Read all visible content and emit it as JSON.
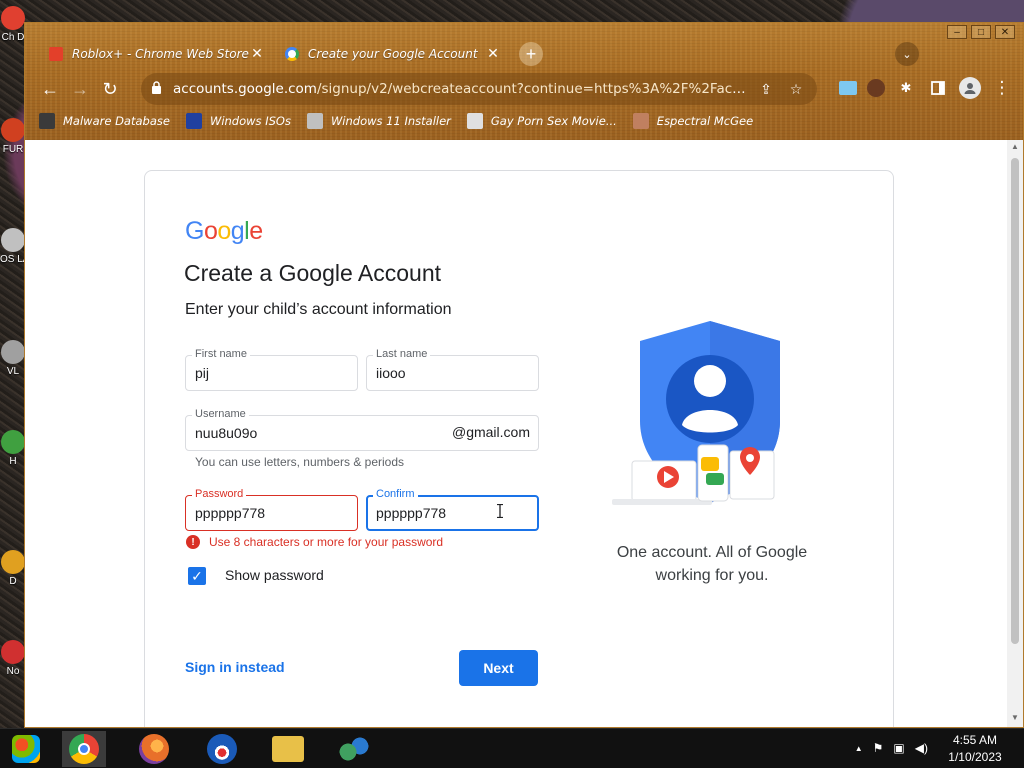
{
  "desktop": {
    "icons": [
      {
        "label": "Ch D",
        "color": "#e04030"
      },
      {
        "label": "FUR",
        "color": "#d04020"
      },
      {
        "label": "OS LA",
        "color": "#c0c0c0"
      },
      {
        "label": "VL",
        "color": "#a0a0a0"
      },
      {
        "label": "H",
        "color": "#40a040"
      },
      {
        "label": "D",
        "color": "#e0a020"
      },
      {
        "label": "No",
        "color": "#d03030"
      }
    ]
  },
  "browser": {
    "window_controls": {
      "minimize": "–",
      "maximize": "□",
      "close": "✕"
    },
    "tabs": [
      {
        "title": "Roblox+ - Chrome Web Store",
        "favicon": "roblox-icon",
        "close": "✕"
      },
      {
        "title": "Create your Google Account",
        "favicon": "google-icon",
        "close": "✕"
      }
    ],
    "new_tab": "+",
    "tab_search": "⌄",
    "toolbar": {
      "back": "←",
      "forward": "→",
      "reload": "↻",
      "lock": "🔒",
      "url_host": "accounts.google.com",
      "url_path": "/signup/v2/webcreateaccount?continue=https%3A%2F%2Faccount...",
      "share": "⇪",
      "star": "☆"
    },
    "extensions": [
      {
        "name": "flag-extension-icon",
        "glyph": "≡",
        "color": "#7ec8f0"
      },
      {
        "name": "avatar-extension-icon",
        "glyph": "●",
        "color": "#6a3a20"
      },
      {
        "name": "puzzle-icon",
        "glyph": "✱",
        "color": "transparent"
      },
      {
        "name": "side-panel-icon",
        "glyph": "▮",
        "color": "transparent"
      },
      {
        "name": "profile-icon",
        "glyph": "●",
        "color": "#e8e8e8"
      },
      {
        "name": "menu-icon",
        "glyph": "⋮",
        "color": "transparent"
      }
    ],
    "bookmarks": [
      {
        "label": "Malware Database",
        "icon_color": "#3a3a3a"
      },
      {
        "label": "Windows ISOs",
        "icon_color": "#2040a0"
      },
      {
        "label": "Windows 11 Installer",
        "icon_color": "#c0c0c0"
      },
      {
        "label": "Gay Porn Sex Movie...",
        "icon_color": "#e0e0e0"
      },
      {
        "label": "Espectral McGee",
        "icon_color": "#c08060"
      }
    ]
  },
  "signup": {
    "logo": [
      "G",
      "o",
      "o",
      "g",
      "l",
      "e"
    ],
    "title": "Create a Google Account",
    "subtitle": "Enter your child’s account information",
    "first_name": {
      "label": "First name",
      "value": "pij"
    },
    "last_name": {
      "label": "Last name",
      "value": "iiooo"
    },
    "username": {
      "label": "Username",
      "value": "nuu8u09o",
      "suffix": "@gmail.com"
    },
    "username_hint": "You can use letters, numbers & periods",
    "password": {
      "label": "Password",
      "value": "pppppp778"
    },
    "confirm": {
      "label": "Confirm",
      "value": "pppppp778"
    },
    "password_error": "Use 8 characters or more for your password",
    "error_icon": "!",
    "show_password": {
      "label": "Show password",
      "checked": true,
      "check_glyph": "✓"
    },
    "sign_in_link": "Sign in instead",
    "next_button": "Next",
    "caption_line1": "One account. All of Google",
    "caption_line2": "working for you."
  },
  "scrollbar": {
    "up": "▲",
    "down": "▼"
  },
  "taskbar": {
    "items": [
      {
        "name": "start-button",
        "color": "#2a7ad0"
      },
      {
        "name": "chrome-taskbar-icon",
        "color": "#4285f4"
      },
      {
        "name": "firefox-taskbar-icon",
        "color": "#e8702a"
      },
      {
        "name": "obama-taskbar-icon",
        "color": "#1a5ab8"
      },
      {
        "name": "file-explorer-taskbar-icon",
        "color": "#e8c048"
      },
      {
        "name": "network-app-taskbar-icon",
        "color": "#40a060"
      }
    ],
    "tray": {
      "chevron": "▲",
      "flag": "⚑",
      "network": "▣",
      "volume": "◀)"
    },
    "time": "4:55 AM",
    "date": "1/10/2023"
  }
}
